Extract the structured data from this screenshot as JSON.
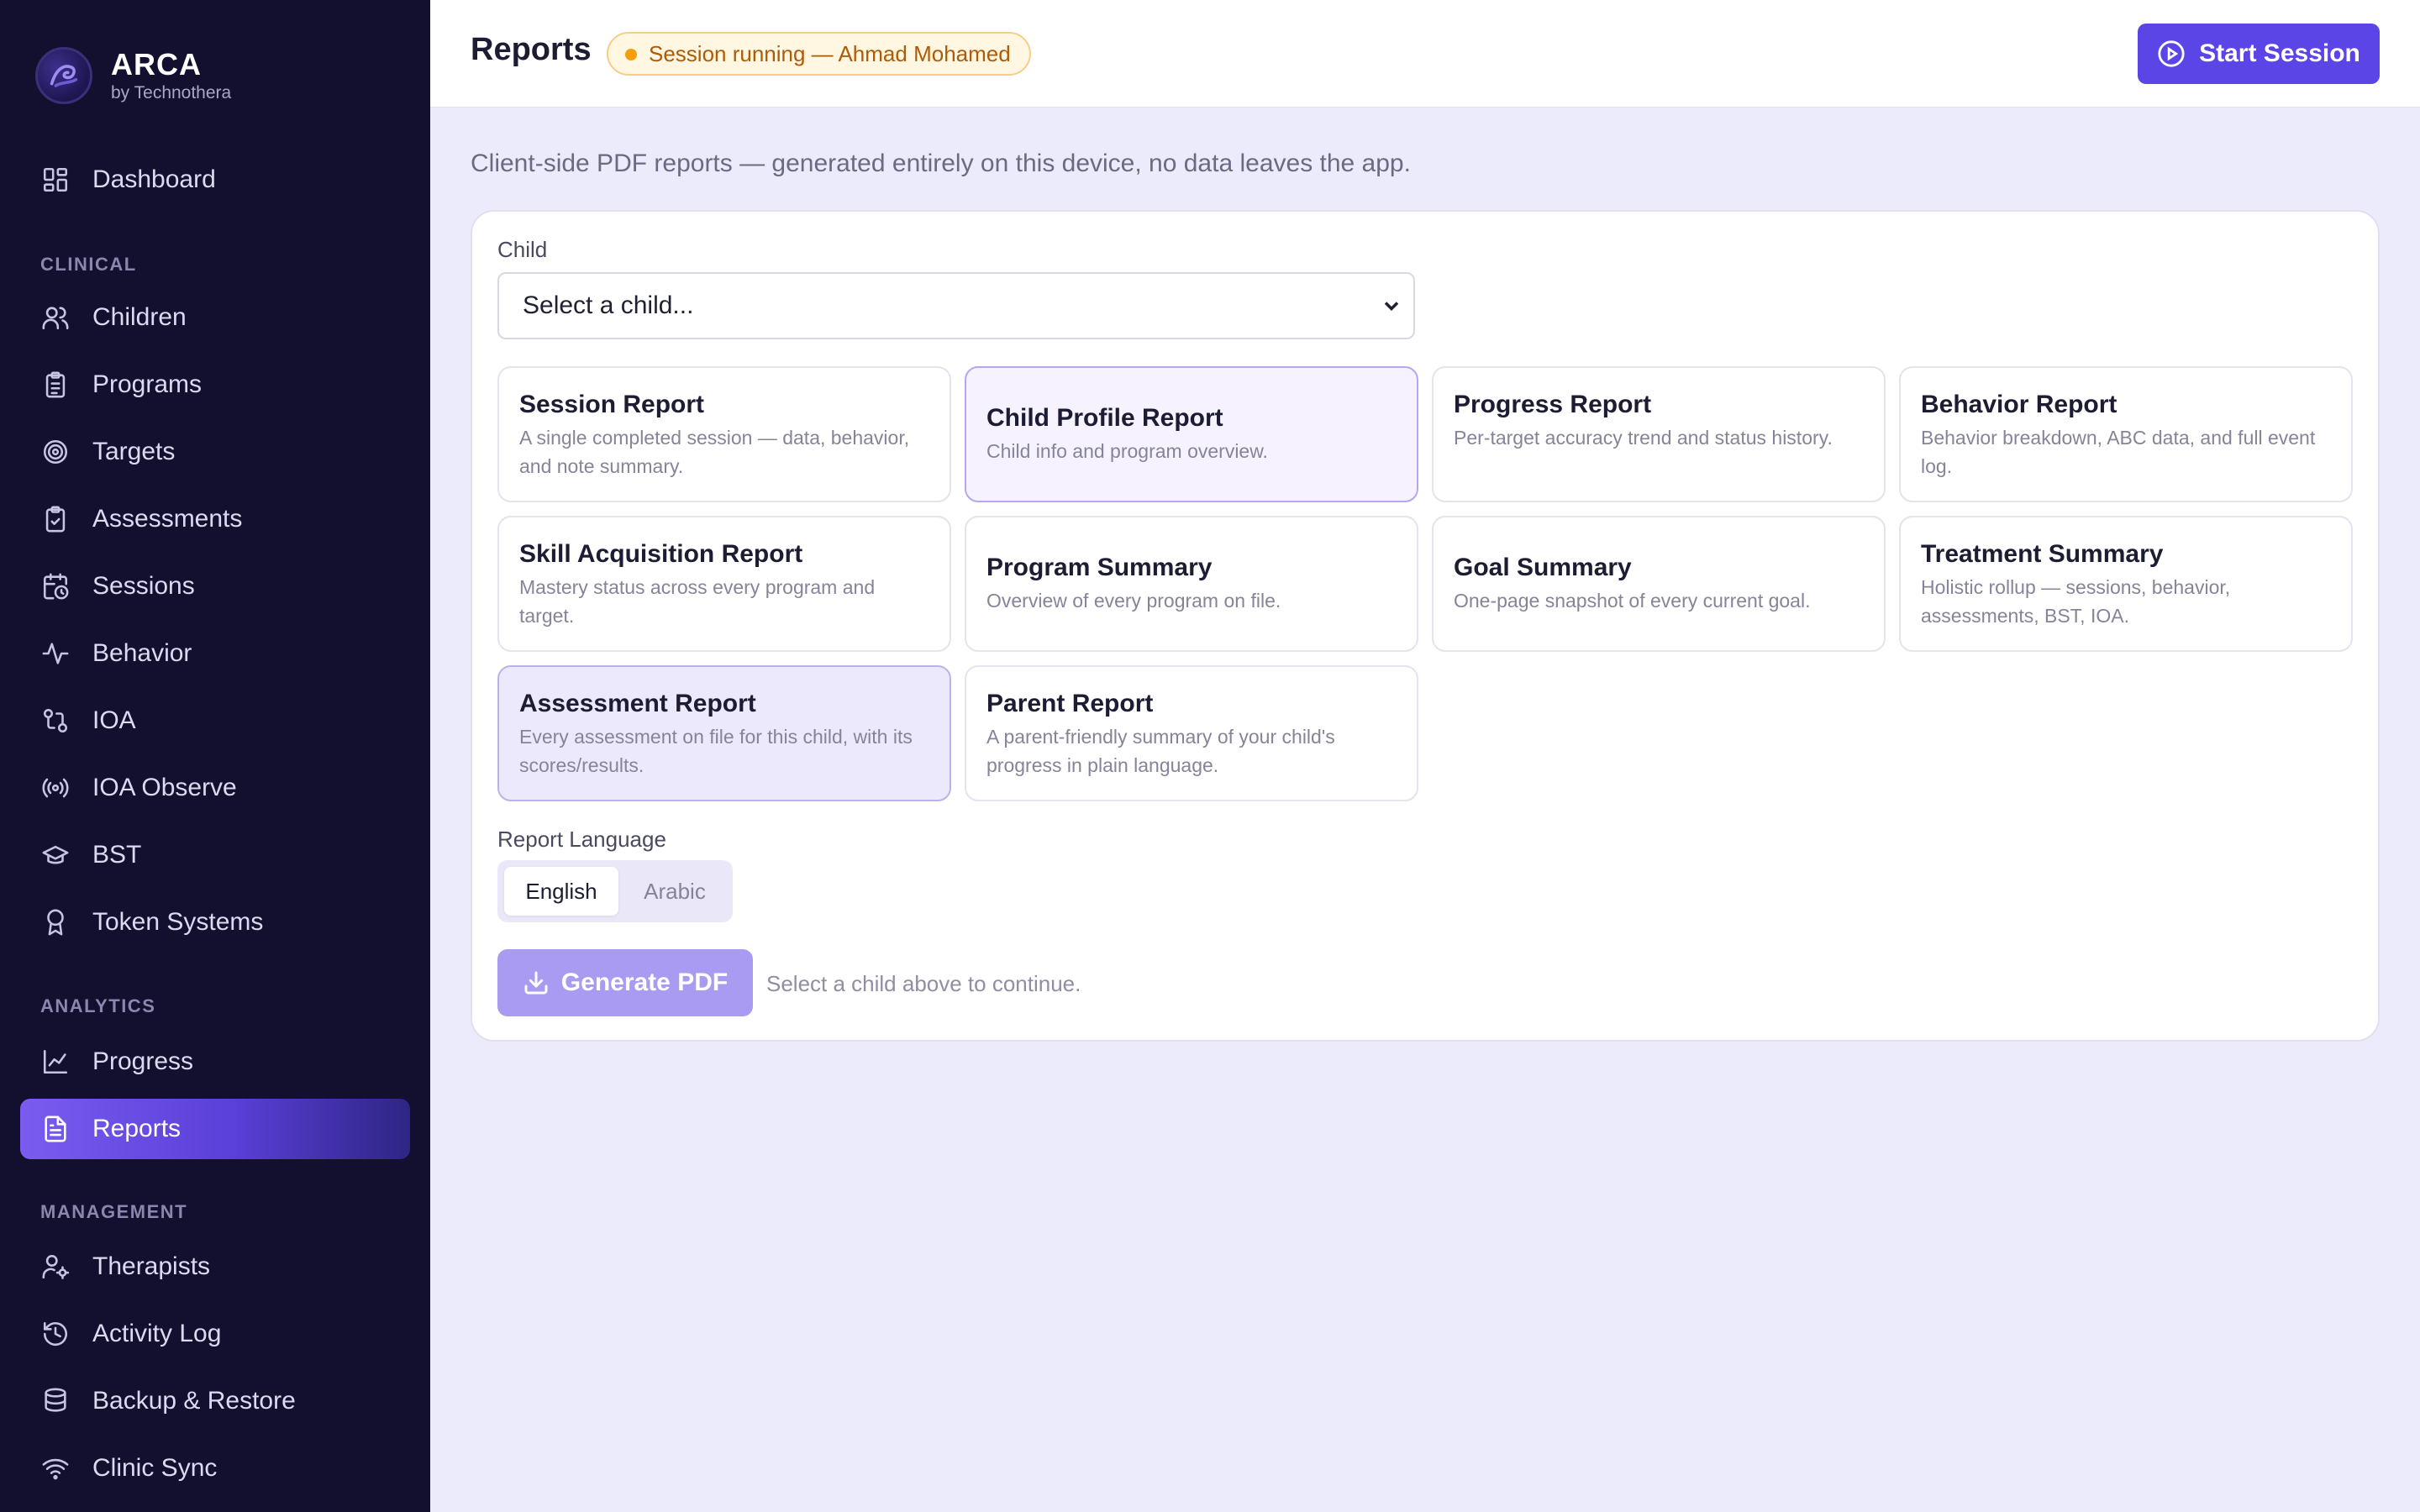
{
  "brand": {
    "name": "ARCA",
    "sub": "by Technothera"
  },
  "sidebar": {
    "top": [
      {
        "label": "Dashboard",
        "icon": "dashboard-icon"
      }
    ],
    "sections": [
      {
        "label": "CLINICAL"
      },
      {
        "label": "ANALYTICS"
      },
      {
        "label": "MANAGEMENT"
      }
    ],
    "clinical": [
      {
        "label": "Children",
        "icon": "users-icon"
      },
      {
        "label": "Programs",
        "icon": "clipboard-icon"
      },
      {
        "label": "Targets",
        "icon": "target-icon"
      },
      {
        "label": "Assessments",
        "icon": "clipboard-check-icon"
      },
      {
        "label": "Sessions",
        "icon": "calendar-clock-icon"
      },
      {
        "label": "Behavior",
        "icon": "activity-icon"
      },
      {
        "label": "IOA",
        "icon": "git-compare-icon"
      },
      {
        "label": "IOA Observe",
        "icon": "radio-icon"
      },
      {
        "label": "BST",
        "icon": "graduation-cap-icon"
      },
      {
        "label": "Token Systems",
        "icon": "award-icon"
      }
    ],
    "analytics": [
      {
        "label": "Progress",
        "icon": "line-chart-icon"
      },
      {
        "label": "Reports",
        "icon": "file-text-icon",
        "active": true
      }
    ],
    "management": [
      {
        "label": "Therapists",
        "icon": "user-cog-icon"
      },
      {
        "label": "Activity Log",
        "icon": "history-icon"
      },
      {
        "label": "Backup & Restore",
        "icon": "database-icon"
      },
      {
        "label": "Clinic Sync",
        "icon": "wifi-icon"
      }
    ]
  },
  "header": {
    "title": "Reports",
    "session_badge": "Session running — Ahmad Mohamed",
    "start_button": "Start Session"
  },
  "main": {
    "subtitle": "Client-side PDF reports — generated entirely on this device, no data leaves the app.",
    "child_label": "Child",
    "child_select_value": "Select a child...",
    "reports": [
      {
        "title": "Session Report",
        "desc": "A single completed session — data, behavior, and note summary."
      },
      {
        "title": "Child Profile Report",
        "desc": "Child info and program overview."
      },
      {
        "title": "Progress Report",
        "desc": "Per-target accuracy trend and status history."
      },
      {
        "title": "Behavior Report",
        "desc": "Behavior breakdown, ABC data, and full event log."
      },
      {
        "title": "Skill Acquisition Report",
        "desc": "Mastery status across every program and target."
      },
      {
        "title": "Program Summary",
        "desc": "Overview of every program on file."
      },
      {
        "title": "Goal Summary",
        "desc": "One-page snapshot of every current goal."
      },
      {
        "title": "Treatment Summary",
        "desc": "Holistic rollup — sessions, behavior, assessments, BST, IOA."
      },
      {
        "title": "Assessment Report",
        "desc": "Every assessment on file for this child, with its scores/results."
      },
      {
        "title": "Parent Report",
        "desc": "A parent-friendly summary of your child's progress in plain language."
      }
    ],
    "language_label": "Report Language",
    "languages": [
      "English",
      "Arabic"
    ],
    "selected_language": "English",
    "generate_button": "Generate PDF",
    "generate_hint": "Select a child above to continue."
  },
  "colors": {
    "sidebar_bg": "#130f2e",
    "accent": "#5b45e6",
    "active_gradient_start": "#7a5cf0",
    "badge_text": "#b05a06",
    "badge_dot": "#f59e0b",
    "page_bg": "#ecebfc"
  }
}
